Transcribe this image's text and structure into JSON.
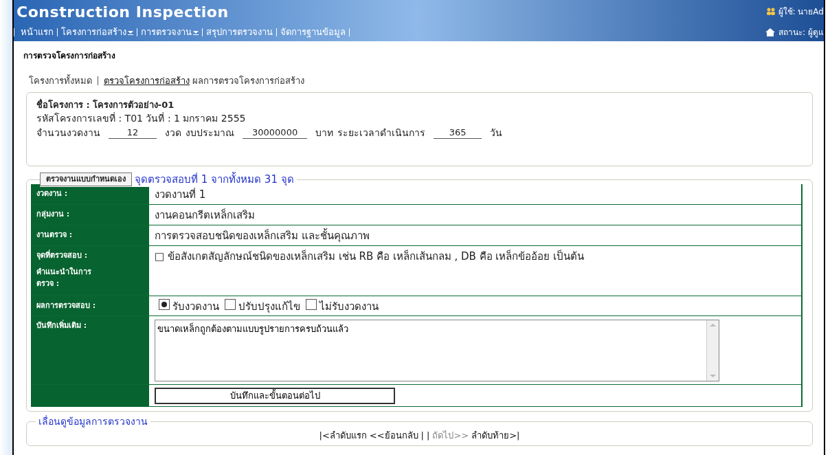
{
  "header": {
    "title": "Construction Inspection",
    "user": "ผู้ใช้: นายAd",
    "status": "สถานะ: ผู้ดูแ"
  },
  "nav": [
    {
      "label": "หน้าแรก",
      "dropdown": false
    },
    {
      "label": "โครงการก่อสร้าง",
      "dropdown": true
    },
    {
      "label": "การตรวจงาน",
      "dropdown": true
    },
    {
      "label": "สรุปการตรวจงาน",
      "dropdown": false
    },
    {
      "label": "จัดการฐานข้อมูล",
      "dropdown": false
    }
  ],
  "page_title": "การตรวจโครงการก่อสร้าง",
  "tabs": [
    {
      "label": "โครงการทั้งหมด",
      "selected": false
    },
    {
      "label": "ตรวจโครงการก่อสร้าง",
      "selected": true
    },
    {
      "label": "ผลการตรวจโครงการก่อสร้าง",
      "selected": false
    }
  ],
  "project": {
    "name_label": "ชื่อโครงการ :",
    "name": "โครงการตัวอย่าง-01",
    "code_line": "รหัสโครงการเลขที่ : T01 วันที่ : 1 มกราคม 2555",
    "fields": [
      {
        "label": "จำนวนงวดงาน",
        "value": "12",
        "unit": "งวด"
      },
      {
        "label": "งบประมาณ",
        "value": "30000000",
        "unit": "บาท"
      },
      {
        "label": "ระยะเวลาดำเนินการ",
        "value": "365",
        "unit": "วัน"
      }
    ]
  },
  "inspection": {
    "mode_button": "ตรวจงานแบบกำหนดเอง",
    "legend": "จุดตรวจสอบที่ 1 จากทั้งหมด 31 จุด",
    "rows": [
      {
        "kind": "text",
        "label": "งวดงาน :",
        "value": "งวดงานที่ 1"
      },
      {
        "kind": "text",
        "label": "กลุ่มงาน :",
        "value": "งานคอนกรีตเหล็กเสริม"
      },
      {
        "kind": "text",
        "label": "งานตรวจ :",
        "value": "การตรวจสอบชนิดของเหล็กเสริม และชั้นคุณภาพ"
      },
      {
        "kind": "point",
        "label": "จุดที่ตรวจสอบ :",
        "label_2": "คำแนะนำในการตรวจ :",
        "value": "□ ข้อสังเกตสัญลักษณ์ชนิดของเหล็กเสริม เช่น RB คือ เหล็กเส้นกลม , DB คือ เหล็กข้ออ้อย เป็นต้น"
      },
      {
        "kind": "radio",
        "label": "ผลการตรวจสอบ :",
        "options": [
          {
            "label": "รับงวดงาน",
            "selected": true
          },
          {
            "label": "ปรับปรุงแก้ไข",
            "selected": false
          },
          {
            "label": "ไม่รับงวดงาน",
            "selected": false
          }
        ]
      },
      {
        "kind": "textarea",
        "label": "บันทึกเพิ่มเติม :",
        "value": "ขนาดเหล็กถูกต้องตามแบบรูปรายการครบถ้วนแล้ว"
      },
      {
        "kind": "button",
        "text": "บันทึกและขั้นตอนต่อไป"
      }
    ]
  },
  "pager": {
    "legend": "เลื่อนดูข้อมูลการตรวจงาน",
    "items": [
      {
        "label": "|<ลำดับแรก",
        "disabled": false
      },
      {
        "label": "<<ย้อนกลับ",
        "disabled": false
      },
      {
        "label": "|",
        "disabled": false
      },
      {
        "label": "|",
        "disabled": false
      },
      {
        "label": "ถัดไป>>",
        "disabled": true
      },
      {
        "label": "ลำดับท้าย>|",
        "disabled": false
      }
    ]
  }
}
